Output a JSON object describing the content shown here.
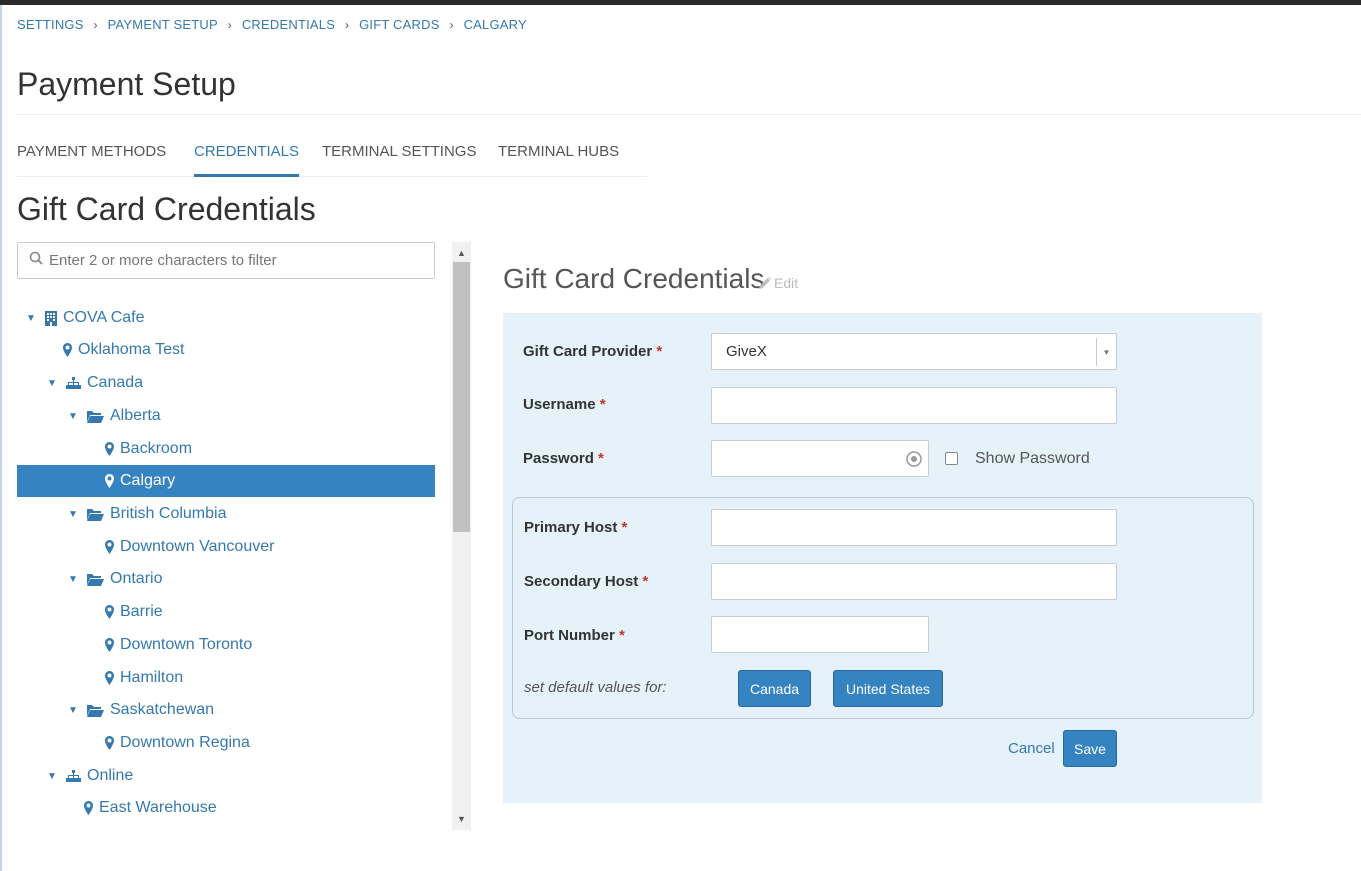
{
  "breadcrumb": [
    "SETTINGS",
    "PAYMENT SETUP",
    "CREDENTIALS",
    "GIFT CARDS",
    "CALGARY"
  ],
  "page_title": "Payment Setup",
  "tabs": [
    {
      "label": "PAYMENT METHODS",
      "active": false
    },
    {
      "label": "CREDENTIALS",
      "active": true
    },
    {
      "label": "TERMINAL SETTINGS",
      "active": false
    },
    {
      "label": "TERMINAL HUBS",
      "active": false
    }
  ],
  "section_title": "Gift Card Credentials",
  "filter": {
    "placeholder": "Enter 2 or more characters to filter"
  },
  "tree": [
    {
      "label": "COVA Cafe",
      "icon": "building-icon",
      "expanded": true
    },
    {
      "label": "Oklahoma Test",
      "icon": "map-marker-icon"
    },
    {
      "label": "Canada",
      "icon": "sitemap-icon",
      "expanded": true
    },
    {
      "label": "Alberta",
      "icon": "folder-open-icon",
      "expanded": true
    },
    {
      "label": "Backroom",
      "icon": "map-marker-icon"
    },
    {
      "label": "Calgary",
      "icon": "map-marker-icon",
      "selected": true
    },
    {
      "label": "British Columbia",
      "icon": "folder-open-icon",
      "expanded": true
    },
    {
      "label": "Downtown Vancouver",
      "icon": "map-marker-icon"
    },
    {
      "label": "Ontario",
      "icon": "folder-open-icon",
      "expanded": true
    },
    {
      "label": "Barrie",
      "icon": "map-marker-icon"
    },
    {
      "label": "Downtown Toronto",
      "icon": "map-marker-icon"
    },
    {
      "label": "Hamilton",
      "icon": "map-marker-icon"
    },
    {
      "label": "Saskatchewan",
      "icon": "folder-open-icon",
      "expanded": true
    },
    {
      "label": "Downtown Regina",
      "icon": "map-marker-icon"
    },
    {
      "label": "Online",
      "icon": "sitemap-icon",
      "expanded": true
    },
    {
      "label": "East Warehouse",
      "icon": "map-marker-icon"
    }
  ],
  "panel": {
    "title": "Gift Card Credentials",
    "edit_label": "Edit",
    "fields": {
      "provider": {
        "label": "Gift Card Provider",
        "value": "GiveX"
      },
      "username": {
        "label": "Username",
        "value": ""
      },
      "password": {
        "label": "Password",
        "value": ""
      },
      "show_password": {
        "label": "Show Password",
        "checked": false
      },
      "primary_host": {
        "label": "Primary Host",
        "value": ""
      },
      "secondary_host": {
        "label": "Secondary Host",
        "value": ""
      },
      "port_number": {
        "label": "Port Number",
        "value": ""
      }
    },
    "required_mark": "*",
    "defaults_text": "set default values for:",
    "default_buttons": [
      "Canada",
      "United States"
    ],
    "cancel_label": "Cancel",
    "save_label": "Save"
  },
  "colors": {
    "accent": "#3583c0",
    "link": "#3479b0",
    "panel_bg": "#e5f2fa",
    "required": "#c9302c"
  }
}
